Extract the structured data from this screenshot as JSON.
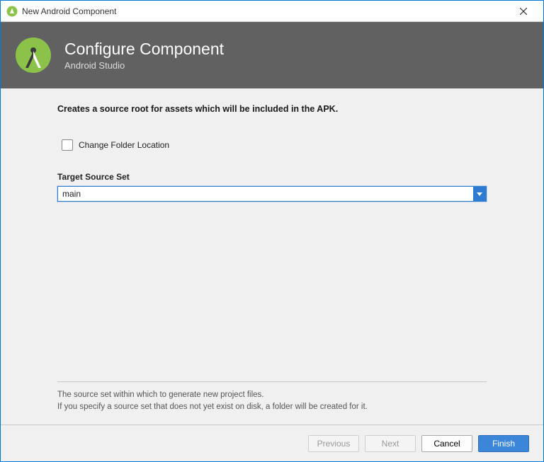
{
  "titlebar": {
    "title": "New Android Component"
  },
  "header": {
    "title": "Configure Component",
    "subtitle": "Android Studio"
  },
  "content": {
    "description": "Creates a source root for assets which will be included in the APK.",
    "checkbox_label": "Change Folder Location",
    "checkbox_checked": false,
    "target_label": "Target Source Set",
    "target_value": "main"
  },
  "help": {
    "line1": "The source set within which to generate new project files.",
    "line2": "If you specify a source set that does not yet exist on disk, a folder will be created for it."
  },
  "footer": {
    "previous": "Previous",
    "next": "Next",
    "cancel": "Cancel",
    "finish": "Finish"
  }
}
